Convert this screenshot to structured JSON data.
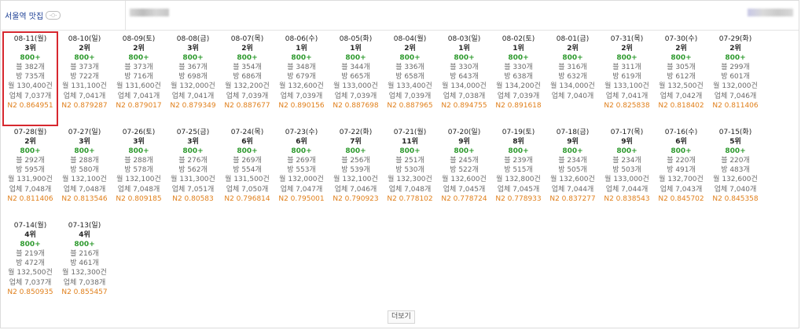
{
  "header": {
    "keyword": "서울역 맛집",
    "keyword_icon": "-○-"
  },
  "more_label": "더보기",
  "selected_index": 0,
  "cards": [
    {
      "date": "08-11(월)",
      "rank": "3위",
      "vol": "800+",
      "blog": "블 382개",
      "cafe": "방 735개",
      "month": "월 130,400건",
      "total": "업체 7,037개",
      "n2": "N2 0.864951"
    },
    {
      "date": "08-10(일)",
      "rank": "2위",
      "vol": "800+",
      "blog": "블 373개",
      "cafe": "방 722개",
      "month": "월 131,100건",
      "total": "업체 7,041개",
      "n2": "N2 0.879287"
    },
    {
      "date": "08-09(토)",
      "rank": "2위",
      "vol": "800+",
      "blog": "블 373개",
      "cafe": "방 716개",
      "month": "월 131,600건",
      "total": "업체 7,041개",
      "n2": "N2 0.879017"
    },
    {
      "date": "08-08(금)",
      "rank": "3위",
      "vol": "800+",
      "blog": "블 367개",
      "cafe": "방 698개",
      "month": "월 132,000건",
      "total": "업체 7,041개",
      "n2": "N2 0.879349"
    },
    {
      "date": "08-07(목)",
      "rank": "2위",
      "vol": "800+",
      "blog": "블 354개",
      "cafe": "방 686개",
      "month": "월 132,200건",
      "total": "업체 7,039개",
      "n2": "N2 0.887677"
    },
    {
      "date": "08-06(수)",
      "rank": "1위",
      "vol": "800+",
      "blog": "블 348개",
      "cafe": "방 679개",
      "month": "월 132,600건",
      "total": "업체 7,039개",
      "n2": "N2 0.890156"
    },
    {
      "date": "08-05(화)",
      "rank": "1위",
      "vol": "800+",
      "blog": "블 344개",
      "cafe": "방 665개",
      "month": "월 133,000건",
      "total": "업체 7,039개",
      "n2": "N2 0.887698"
    },
    {
      "date": "08-04(월)",
      "rank": "2위",
      "vol": "800+",
      "blog": "블 336개",
      "cafe": "방 658개",
      "month": "월 133,400건",
      "total": "업체 7,039개",
      "n2": "N2 0.887965"
    },
    {
      "date": "08-03(일)",
      "rank": "1위",
      "vol": "800+",
      "blog": "블 330개",
      "cafe": "방 643개",
      "month": "월 134,000건",
      "total": "업체 7,038개",
      "n2": "N2 0.894755"
    },
    {
      "date": "08-02(토)",
      "rank": "1위",
      "vol": "800+",
      "blog": "블 330개",
      "cafe": "방 638개",
      "month": "월 134,200건",
      "total": "업체 7,039개",
      "n2": "N2 0.891618"
    },
    {
      "date": "08-01(금)",
      "rank": "2위",
      "vol": "800+",
      "blog": "블 316개",
      "cafe": "방 632개",
      "month": "월 134,000건",
      "total": "업체 7,040개",
      "n2": ""
    },
    {
      "date": "07-31(목)",
      "rank": "2위",
      "vol": "800+",
      "blog": "블 311개",
      "cafe": "방 619개",
      "month": "월 133,100건",
      "total": "업체 7,041개",
      "n2": "N2 0.825838"
    },
    {
      "date": "07-30(수)",
      "rank": "2위",
      "vol": "800+",
      "blog": "블 305개",
      "cafe": "방 612개",
      "month": "월 132,500건",
      "total": "업체 7,042개",
      "n2": "N2 0.818402"
    },
    {
      "date": "07-29(화)",
      "rank": "2위",
      "vol": "800+",
      "blog": "블 299개",
      "cafe": "방 601개",
      "month": "월 132,000건",
      "total": "업체 7,046개",
      "n2": "N2 0.811406"
    },
    {
      "date": "07-28(월)",
      "rank": "2위",
      "vol": "800+",
      "blog": "블 292개",
      "cafe": "방 595개",
      "month": "월 131,900건",
      "total": "업체 7,048개",
      "n2": "N2 0.811406"
    },
    {
      "date": "07-27(일)",
      "rank": "3위",
      "vol": "800+",
      "blog": "블 288개",
      "cafe": "방 580개",
      "month": "월 132,100건",
      "total": "업체 7,048개",
      "n2": "N2 0.813546"
    },
    {
      "date": "07-26(토)",
      "rank": "3위",
      "vol": "800+",
      "blog": "블 288개",
      "cafe": "방 578개",
      "month": "월 132,100건",
      "total": "업체 7,048개",
      "n2": "N2 0.809185"
    },
    {
      "date": "07-25(금)",
      "rank": "3위",
      "vol": "800+",
      "blog": "블 276개",
      "cafe": "방 562개",
      "month": "월 131,300건",
      "total": "업체 7,051개",
      "n2": "N2 0.80583"
    },
    {
      "date": "07-24(목)",
      "rank": "6위",
      "vol": "800+",
      "blog": "블 269개",
      "cafe": "방 554개",
      "month": "월 131,500건",
      "total": "업체 7,050개",
      "n2": "N2 0.796814"
    },
    {
      "date": "07-23(수)",
      "rank": "6위",
      "vol": "800+",
      "blog": "블 269개",
      "cafe": "방 553개",
      "month": "월 132,000건",
      "total": "업체 7,047개",
      "n2": "N2 0.795001"
    },
    {
      "date": "07-22(화)",
      "rank": "7위",
      "vol": "800+",
      "blog": "블 256개",
      "cafe": "방 539개",
      "month": "월 132,100건",
      "total": "업체 7,046개",
      "n2": "N2 0.790923"
    },
    {
      "date": "07-21(월)",
      "rank": "11위",
      "vol": "800+",
      "blog": "블 251개",
      "cafe": "방 530개",
      "month": "월 132,300건",
      "total": "업체 7,048개",
      "n2": "N2 0.778102"
    },
    {
      "date": "07-20(일)",
      "rank": "9위",
      "vol": "800+",
      "blog": "블 245개",
      "cafe": "방 522개",
      "month": "월 132,600건",
      "total": "업체 7,045개",
      "n2": "N2 0.778724"
    },
    {
      "date": "07-19(토)",
      "rank": "8위",
      "vol": "800+",
      "blog": "블 239개",
      "cafe": "방 515개",
      "month": "월 132,800건",
      "total": "업체 7,045개",
      "n2": "N2 0.778933"
    },
    {
      "date": "07-18(금)",
      "rank": "9위",
      "vol": "800+",
      "blog": "블 234개",
      "cafe": "방 505개",
      "month": "월 132,600건",
      "total": "업체 7,044개",
      "n2": "N2 0.837277"
    },
    {
      "date": "07-17(목)",
      "rank": "9위",
      "vol": "800+",
      "blog": "블 234개",
      "cafe": "방 503개",
      "month": "월 133,000건",
      "total": "업체 7,044개",
      "n2": "N2 0.838543"
    },
    {
      "date": "07-16(수)",
      "rank": "6위",
      "vol": "800+",
      "blog": "블 220개",
      "cafe": "방 491개",
      "month": "월 132,700건",
      "total": "업체 7,043개",
      "n2": "N2 0.845702"
    },
    {
      "date": "07-15(화)",
      "rank": "5위",
      "vol": "800+",
      "blog": "블 220개",
      "cafe": "방 483개",
      "month": "월 132,600건",
      "total": "업체 7,040개",
      "n2": "N2 0.845358"
    },
    {
      "date": "07-14(월)",
      "rank": "4위",
      "vol": "800+",
      "blog": "블 219개",
      "cafe": "방 472개",
      "month": "월 132,500건",
      "total": "업체 7,037개",
      "n2": "N2 0.850935"
    },
    {
      "date": "07-13(일)",
      "rank": "4위",
      "vol": "800+",
      "blog": "블 216개",
      "cafe": "방 461개",
      "month": "월 132,300건",
      "total": "업체 7,038개",
      "n2": "N2 0.855457"
    }
  ]
}
